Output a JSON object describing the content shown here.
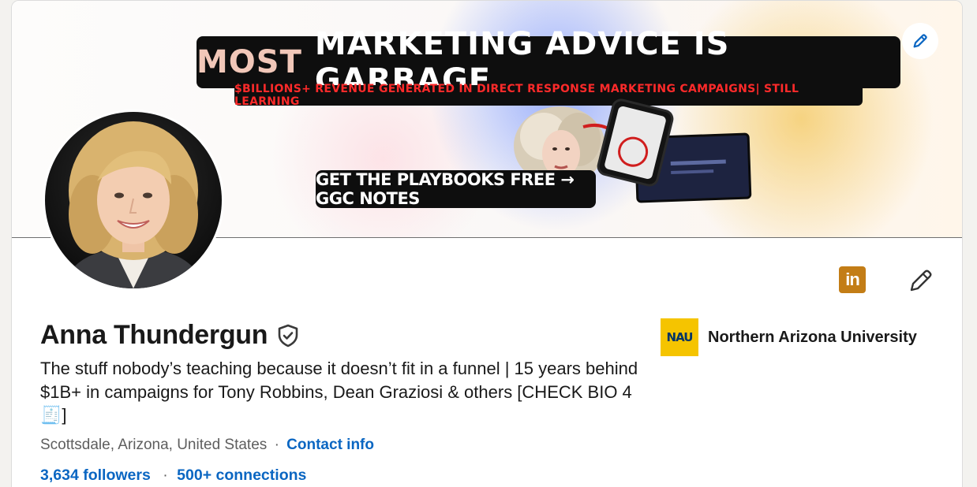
{
  "banner": {
    "headline_part1": "MOST",
    "headline_part2": "MARKETING ADVICE IS GARBAGE",
    "subheadline": "$BILLIONS+ REVENUE GENERATED IN DIRECT RESPONSE MARKETING CAMPAIGNS| STILL LEARNING",
    "cta": "GET THE PLAYBOOKS FREE → GGC NOTES"
  },
  "profile": {
    "name": "Anna Thundergun",
    "headline": "The stuff nobody’s teaching because it doesn’t fit in a funnel | 15 years behind $1B+ in campaigns for Tony Robbins, Dean Graziosi & others [CHECK BIO 4 🧾]",
    "location": "Scottsdale, Arizona, United States",
    "location_separator": "·",
    "contact_label": "Contact info",
    "followers": "3,634 followers",
    "stats_separator": "·",
    "connections": "500+ connections"
  },
  "school": {
    "logo_text": "NAU",
    "name": "Northern Arizona University"
  },
  "icons": {
    "linkedin_text": "in",
    "linkedin_color": "#c37d16",
    "link_color": "#0a66c2"
  }
}
